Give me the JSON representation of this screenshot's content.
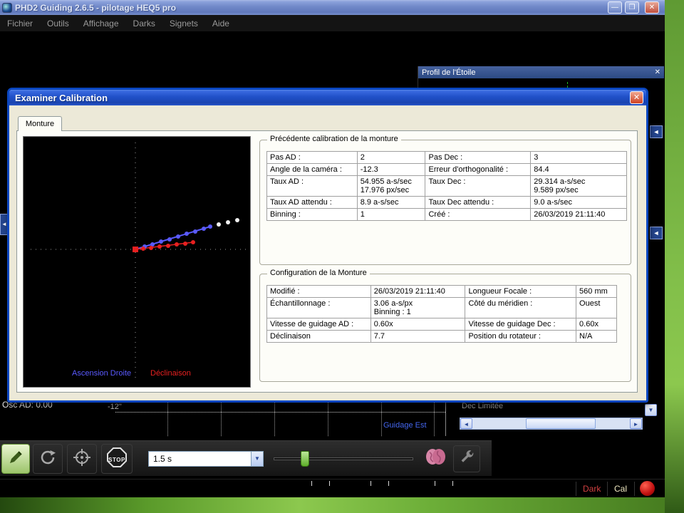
{
  "colors": {
    "ra_blue": "#5a5aff",
    "dec_red": "#e82020",
    "guide_blue": "#4466ee",
    "profile_green": "#20c020",
    "status_red": "#d04040"
  },
  "window": {
    "title": "PHD2 Guiding 2.6.5 - pilotage HEQ5 pro",
    "menu": [
      "Fichier",
      "Outils",
      "Affichage",
      "Darks",
      "Signets",
      "Aide"
    ]
  },
  "icons": {
    "close": "✕",
    "minimize": "—",
    "maximize": "❒",
    "dropdown": "▼",
    "scroll_left": "◄",
    "scroll_right": "►",
    "scroll_down": "▼",
    "dock_collapse": "◄"
  },
  "star_profile": {
    "title": "Profil de l'Étoile"
  },
  "dialog": {
    "title": "Examiner Calibration",
    "tab": "Monture",
    "legend": {
      "ra": "Ascension Droite",
      "dec": "Déclinaison"
    },
    "prev_calibration": {
      "title": "Précédente calibration de la monture",
      "rows": [
        [
          "Pas AD :",
          "2",
          "Pas Dec :",
          "3"
        ],
        [
          "Angle de la caméra :",
          "-12.3",
          "Erreur d'orthogonalité :",
          "84.4"
        ],
        [
          "Taux AD :",
          "54.955 a-s/sec\n17.976 px/sec",
          "Taux Dec :",
          "29.314 a-s/sec\n9.589 px/sec"
        ],
        [
          "Taux AD attendu :",
          "8.9 a-s/sec",
          "Taux Dec attendu :",
          "9.0 a-s/sec"
        ],
        [
          "Binning :",
          "1",
          "Créé :",
          "26/03/2019 21:11:40"
        ]
      ]
    },
    "mount_config": {
      "title": "Configuration de la Monture",
      "rows": [
        [
          "Modifié :",
          "26/03/2019 21:11:40",
          "Longueur Focale :",
          "560 mm"
        ],
        [
          "Échantillonnage :",
          "3.06 a-s/px\nBinning : 1",
          "Côté du méridien :",
          "Ouest"
        ],
        [
          "Vitesse de guidage AD :",
          "0.60x",
          "Vitesse de guidage Dec :",
          "0.60x"
        ],
        [
          "Déclinaison",
          "7.7",
          "Position du rotateur :",
          "N/A"
        ]
      ]
    },
    "plot": {
      "origin": [
        157,
        158
      ],
      "ra_line": [
        [
          157,
          158
        ],
        [
          262,
          126
        ]
      ],
      "dec_line": [
        [
          157,
          158
        ],
        [
          238,
          148
        ]
      ],
      "ra_points": [
        [
          170,
          154
        ],
        [
          181,
          151
        ],
        [
          193,
          147
        ],
        [
          205,
          144
        ],
        [
          217,
          140
        ],
        [
          229,
          136
        ],
        [
          241,
          133
        ],
        [
          253,
          129
        ],
        [
          262,
          126
        ]
      ],
      "dec_points": [
        [
          168,
          157
        ],
        [
          179,
          156
        ],
        [
          191,
          154
        ],
        [
          203,
          153
        ],
        [
          215,
          151
        ],
        [
          227,
          150
        ],
        [
          238,
          148
        ]
      ],
      "extra_points": [
        [
          274,
          123
        ],
        [
          287,
          120
        ],
        [
          300,
          117
        ]
      ]
    }
  },
  "graph": {
    "osc": "Osc AD: 0.00",
    "scale": "-12\"",
    "direction": "Guidage Est"
  },
  "side_panel": {
    "label": "Dec Limitée"
  },
  "toolbar": {
    "exposure": "1.5 s",
    "stop": "STOP"
  },
  "status": {
    "dark": "Dark",
    "cal": "Cal"
  }
}
